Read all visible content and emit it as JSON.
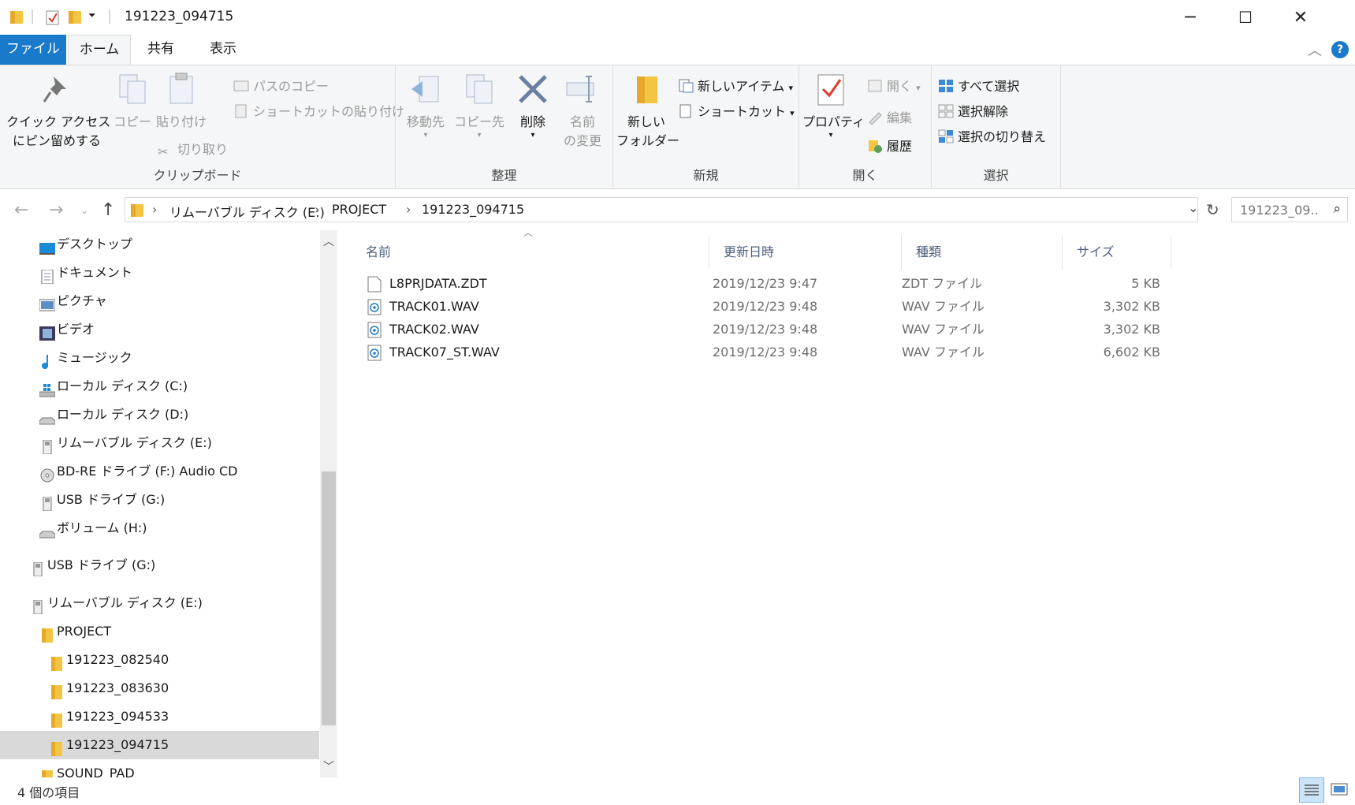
{
  "window": {
    "title": "191223_094715",
    "minimize": "─",
    "maximize": "☐",
    "close": "✕"
  },
  "tabs": [
    {
      "label": "ファイル"
    },
    {
      "label": "ホーム"
    },
    {
      "label": "共有"
    },
    {
      "label": "表示"
    }
  ],
  "ribbon": {
    "clipboard": {
      "label": "クリップボード",
      "pin": "クイック アクセス\nにピン留めする",
      "copy": "コピー",
      "paste": "貼り付け",
      "copy_path": "パスのコピー",
      "paste_shortcut": "ショートカットの貼り付け",
      "cut": "切り取り"
    },
    "organize": {
      "label": "整理",
      "move_to": "移動先",
      "copy_to": "コピー先",
      "delete": "削除",
      "rename": "名前\nの変更"
    },
    "new": {
      "label": "新規",
      "new_folder": "新しい\nフォルダー",
      "new_item": "新しいアイテム",
      "shortcut": "ショートカット"
    },
    "open": {
      "label": "開く",
      "properties": "プロパティ",
      "open": "開く",
      "edit": "編集",
      "history": "履歴"
    },
    "select": {
      "label": "選択",
      "select_all": "すべて選択",
      "select_none": "選択解除",
      "invert": "選択の切り替え"
    }
  },
  "address": {
    "crumbs": [
      "リムーバブル ディスク (E:)",
      "PROJECT",
      "191223_094715"
    ],
    "search_placeholder": "191223_09..."
  },
  "nav": {
    "items": [
      {
        "label": "デスクトップ",
        "icon": "desktop-icon"
      },
      {
        "label": "ドキュメント",
        "icon": "documents-icon"
      },
      {
        "label": "ピクチャ",
        "icon": "pictures-icon"
      },
      {
        "label": "ビデオ",
        "icon": "videos-icon"
      },
      {
        "label": "ミュージック",
        "icon": "music-icon"
      },
      {
        "label": "ローカル ディスク (C:)",
        "icon": "windows-drive-icon"
      },
      {
        "label": "ローカル ディスク (D:)",
        "icon": "drive-icon"
      },
      {
        "label": "リムーバブル ディスク (E:)",
        "icon": "removable-drive-icon"
      },
      {
        "label": "BD-RE ドライブ (F:) Audio CD",
        "icon": "cd-drive-icon"
      },
      {
        "label": "USB ドライブ (G:)",
        "icon": "usb-drive-icon"
      },
      {
        "label": "ボリューム (H:)",
        "icon": "drive-icon"
      },
      {
        "label": "USB ドライブ (G:)",
        "icon": "usb-drive-icon"
      },
      {
        "label": "リムーバブル ディスク (E:)",
        "icon": "removable-drive-icon"
      },
      {
        "label": "PROJECT",
        "icon": "folder-icon"
      },
      {
        "label": "191223_082540",
        "icon": "folder-icon"
      },
      {
        "label": "191223_083630",
        "icon": "folder-icon"
      },
      {
        "label": "191223_094533",
        "icon": "folder-icon"
      },
      {
        "label": "191223_094715",
        "icon": "folder-icon",
        "selected": true
      },
      {
        "label": "SOUND_PAD",
        "icon": "folder-icon"
      }
    ]
  },
  "files": {
    "columns": [
      "名前",
      "更新日時",
      "種類",
      "サイズ"
    ],
    "rows": [
      {
        "name": "L8PRJDATA.ZDT",
        "date": "2019/12/23 9:47",
        "type": "ZDT ファイル",
        "size": "5 KB",
        "icon": "file-icon"
      },
      {
        "name": "TRACK01.WAV",
        "date": "2019/12/23 9:48",
        "type": "WAV ファイル",
        "size": "3,302 KB",
        "icon": "audio-file-icon"
      },
      {
        "name": "TRACK02.WAV",
        "date": "2019/12/23 9:48",
        "type": "WAV ファイル",
        "size": "3,302 KB",
        "icon": "audio-file-icon"
      },
      {
        "name": "TRACK07_ST.WAV",
        "date": "2019/12/23 9:48",
        "type": "WAV ファイル",
        "size": "6,602 KB",
        "icon": "audio-file-icon"
      }
    ]
  },
  "status": {
    "count_text": "4 個の項目"
  },
  "colors": {
    "accent": "#1979ca",
    "selected_nav": "#d9d9d9",
    "ribbon_bg": "#f5f6f7"
  }
}
